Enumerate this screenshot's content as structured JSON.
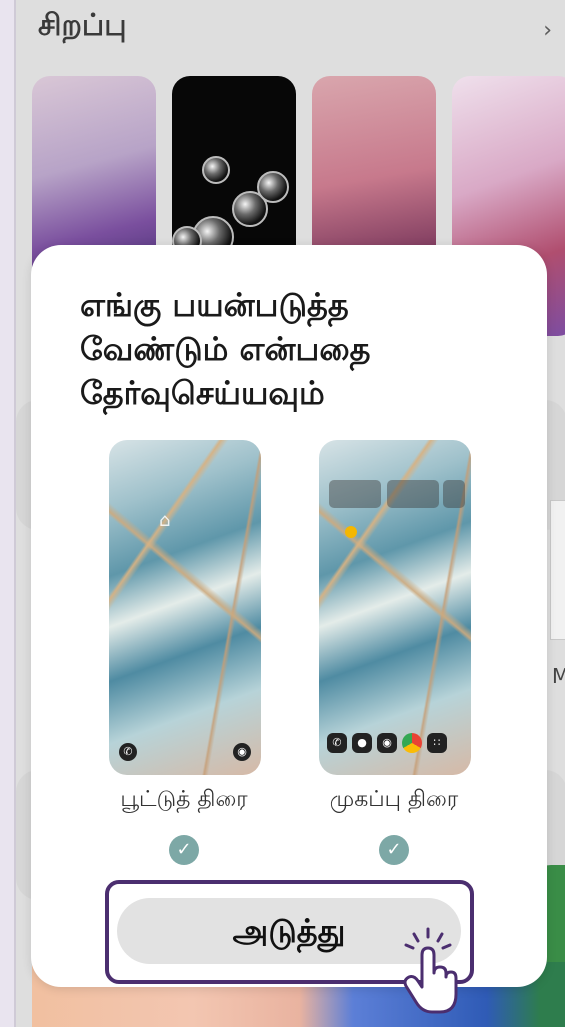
{
  "background": {
    "section_title": "சிறப்பு",
    "chevron": "›",
    "partial_side_text": "MD"
  },
  "dialog": {
    "title": "எங்கு பயன்படுத்த\nவேண்டும் என்பதை\nதேர்வுசெய்யவும்",
    "options": [
      {
        "label": "பூட்டுத் திரை",
        "checked": true
      },
      {
        "label": "முகப்பு திரை",
        "checked": true
      }
    ],
    "next_label": "அடுத்து"
  },
  "icons": {
    "check": "check-icon",
    "hand": "tap-hand-icon",
    "chevron": "chevron-right-icon"
  },
  "colors": {
    "check": "#7da8a6",
    "highlight_border": "#4b2e6f",
    "button_bg": "#e2e2e2"
  }
}
